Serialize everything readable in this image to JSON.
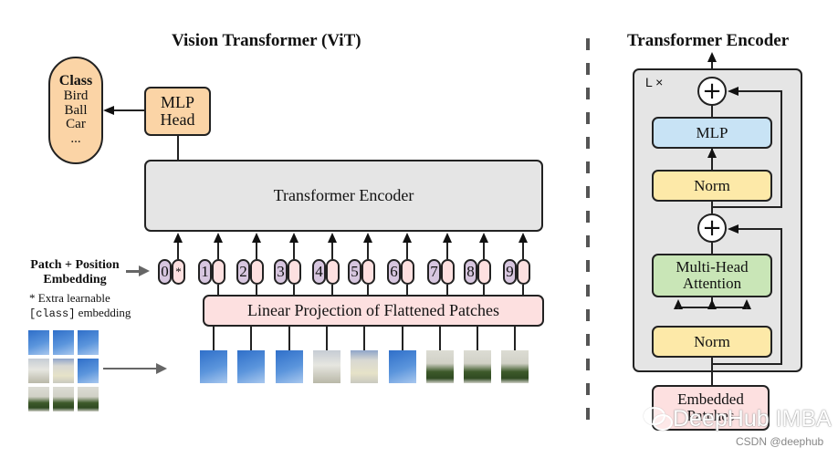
{
  "vit": {
    "title": "Vision Transformer (ViT)",
    "class_box": {
      "heading": "Class",
      "items": [
        "Bird",
        "Ball",
        "Car",
        "..."
      ]
    },
    "mlp_head": {
      "line1": "MLP",
      "line2": "Head"
    },
    "encoder_label": "Transformer Encoder",
    "embedding_label": {
      "line1": "Patch + Position",
      "line2": "Embedding"
    },
    "note": {
      "line1": "* Extra learnable",
      "code": "[class]",
      "line2_rest": " embedding"
    },
    "tokens": [
      {
        "position": "0",
        "embedding": "*"
      },
      {
        "position": "1",
        "embedding": ""
      },
      {
        "position": "2",
        "embedding": ""
      },
      {
        "position": "3",
        "embedding": ""
      },
      {
        "position": "4",
        "embedding": ""
      },
      {
        "position": "5",
        "embedding": ""
      },
      {
        "position": "6",
        "embedding": ""
      },
      {
        "position": "7",
        "embedding": ""
      },
      {
        "position": "8",
        "embedding": ""
      },
      {
        "position": "9",
        "embedding": ""
      }
    ],
    "projection_label": "Linear Projection of Flattened Patches",
    "patch_count": 9
  },
  "encoder": {
    "title": "Transformer Encoder",
    "repeat_label": "L ×",
    "mlp": "MLP",
    "norm_top": "Norm",
    "mha": {
      "line1": "Multi-Head",
      "line2": "Attention"
    },
    "norm_bottom": "Norm",
    "embedded": {
      "line1": "Embedded",
      "line2": "Patches"
    },
    "add_symbol": "+"
  },
  "colors": {
    "orange": "#fbd4a6",
    "grey": "#e5e5e5",
    "pink": "#fde0e0",
    "purple": "#d7c6df",
    "blue": "#c8e3f5",
    "yellow": "#fde9a8",
    "green": "#c9e6b7"
  },
  "watermark": {
    "main": "DeepHub IMBA",
    "credit": "CSDN @deephub"
  }
}
